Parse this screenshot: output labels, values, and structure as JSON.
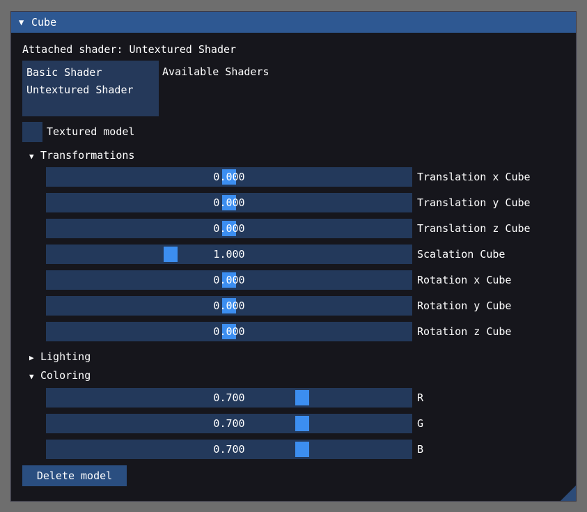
{
  "window": {
    "title": "Cube",
    "collapse_icon": "triangle-down-icon"
  },
  "attached_shader": {
    "label": "Attached shader: Untextured Shader"
  },
  "shader_list": {
    "items": [
      "Basic Shader",
      "Untextured Shader"
    ],
    "label": "Available Shaders"
  },
  "textured_checkbox": {
    "label": "Textured model",
    "checked": false
  },
  "sections": {
    "transformations": "Transformations",
    "lighting": "Lighting",
    "coloring": "Coloring"
  },
  "transform_sliders": [
    {
      "value": "0.000",
      "label": "Translation x Cube",
      "fraction": 0.5
    },
    {
      "value": "0.000",
      "label": "Translation y Cube",
      "fraction": 0.5
    },
    {
      "value": "0.000",
      "label": "Translation z Cube",
      "fraction": 0.5
    },
    {
      "value": "1.000",
      "label": "Scalation Cube",
      "fraction": 0.34
    },
    {
      "value": "0.000",
      "label": "Rotation x Cube",
      "fraction": 0.5
    },
    {
      "value": "0.000",
      "label": "Rotation y Cube",
      "fraction": 0.5
    },
    {
      "value": "0.000",
      "label": "Rotation z Cube",
      "fraction": 0.5
    }
  ],
  "color_sliders": [
    {
      "value": "0.700",
      "label": "R",
      "fraction": 0.7
    },
    {
      "value": "0.700",
      "label": "G",
      "fraction": 0.7
    },
    {
      "value": "0.700",
      "label": "B",
      "fraction": 0.7
    }
  ],
  "delete_button": {
    "label": "Delete model"
  },
  "colors": {
    "title_bar": "#2e5892",
    "frame_bg": "#23395b",
    "slider_grab": "#3c8ef0",
    "window_bg": "#16161c",
    "button_bg": "#2a4e80"
  }
}
